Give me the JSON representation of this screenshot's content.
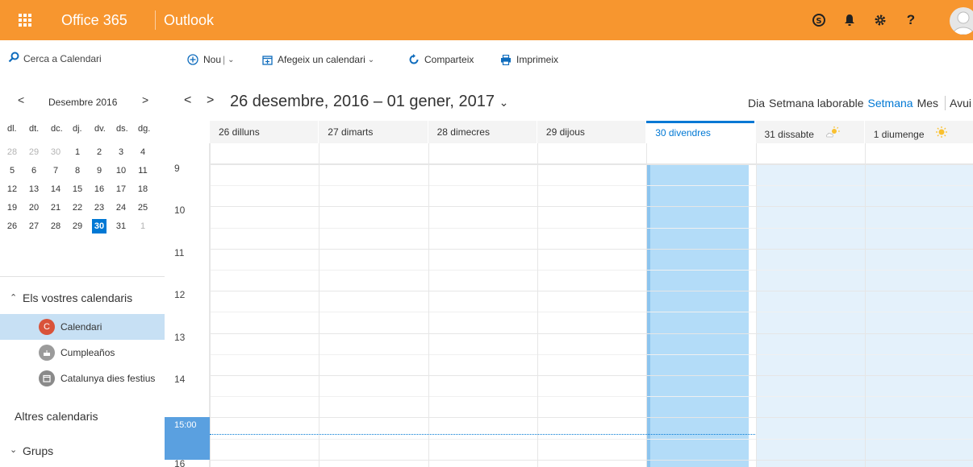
{
  "topbar": {
    "brand": "Office 365",
    "app": "Outlook",
    "icons": [
      "skype-icon",
      "bell-icon",
      "gear-icon",
      "help-icon",
      "avatar"
    ],
    "help_label": "?"
  },
  "search": {
    "placeholder": "Cerca a Calendari"
  },
  "toolbar": {
    "new_label": "Nou",
    "new_sep": "|",
    "add_calendar_label": "Afegeix un calendari",
    "share_label": "Comparteix",
    "print_label": "Imprimeix"
  },
  "mini_calendar": {
    "month_label": "Desembre 2016",
    "prev": "<",
    "next": ">",
    "weekdays": [
      "dl.",
      "dt.",
      "dc.",
      "dj.",
      "dv.",
      "ds.",
      "dg."
    ],
    "weeks": [
      [
        {
          "d": "28",
          "o": true
        },
        {
          "d": "29",
          "o": true
        },
        {
          "d": "30",
          "o": true
        },
        {
          "d": "1"
        },
        {
          "d": "2"
        },
        {
          "d": "3"
        },
        {
          "d": "4"
        }
      ],
      [
        {
          "d": "5"
        },
        {
          "d": "6"
        },
        {
          "d": "7"
        },
        {
          "d": "8"
        },
        {
          "d": "9"
        },
        {
          "d": "10"
        },
        {
          "d": "11"
        }
      ],
      [
        {
          "d": "12"
        },
        {
          "d": "13"
        },
        {
          "d": "14"
        },
        {
          "d": "15"
        },
        {
          "d": "16"
        },
        {
          "d": "17"
        },
        {
          "d": "18"
        }
      ],
      [
        {
          "d": "19"
        },
        {
          "d": "20"
        },
        {
          "d": "21"
        },
        {
          "d": "22"
        },
        {
          "d": "23"
        },
        {
          "d": "24"
        },
        {
          "d": "25"
        }
      ],
      [
        {
          "d": "26"
        },
        {
          "d": "27"
        },
        {
          "d": "28"
        },
        {
          "d": "29"
        },
        {
          "d": "30",
          "sel": true
        },
        {
          "d": "31"
        },
        {
          "d": "1",
          "o": true
        }
      ]
    ]
  },
  "sidebar": {
    "your_calendars": "Els vostres calendaris",
    "calendars": [
      {
        "name": "Calendari",
        "initial": "C",
        "color": "#d9533a",
        "icon": "letter-c-icon",
        "active": true
      },
      {
        "name": "Cumpleaños",
        "initial": "",
        "color": "#9b9b9b",
        "icon": "cake-icon",
        "active": false
      },
      {
        "name": "Catalunya dies festius",
        "initial": "",
        "color": "#8a8a8a",
        "icon": "calendar-icon",
        "active": false
      }
    ],
    "other_calendars": "Altres calendaris",
    "groups": "Grups"
  },
  "range": {
    "prev": "<",
    "next": ">",
    "label": "26 desembre, 2016 – 01 gener, 2017",
    "chevron": "⌄"
  },
  "views": {
    "day": "Dia",
    "work_week": "Setmana laborable",
    "week": "Setmana",
    "month": "Mes",
    "today": "Avui",
    "active": "week"
  },
  "days": [
    {
      "label": "26 dilluns"
    },
    {
      "label": "27 dimarts"
    },
    {
      "label": "28 dimecres"
    },
    {
      "label": "29 dijous"
    },
    {
      "label": "30 divendres",
      "today": true
    },
    {
      "label": "31 dissabte",
      "weather": "partly-sunny-icon",
      "weekend": true
    },
    {
      "label": "1 diumenge",
      "weather": "sun-icon",
      "weekend": true
    }
  ],
  "hours": [
    "9",
    "10",
    "11",
    "12",
    "13",
    "14",
    "15:00",
    "16"
  ],
  "current_time": "15:00",
  "colors": {
    "header": "#f7962f",
    "accent": "#0078d4",
    "today_column": "#b3dcf8",
    "weekend_column": "#e4f1fb",
    "selected_calendar": "#c7e0f4"
  }
}
